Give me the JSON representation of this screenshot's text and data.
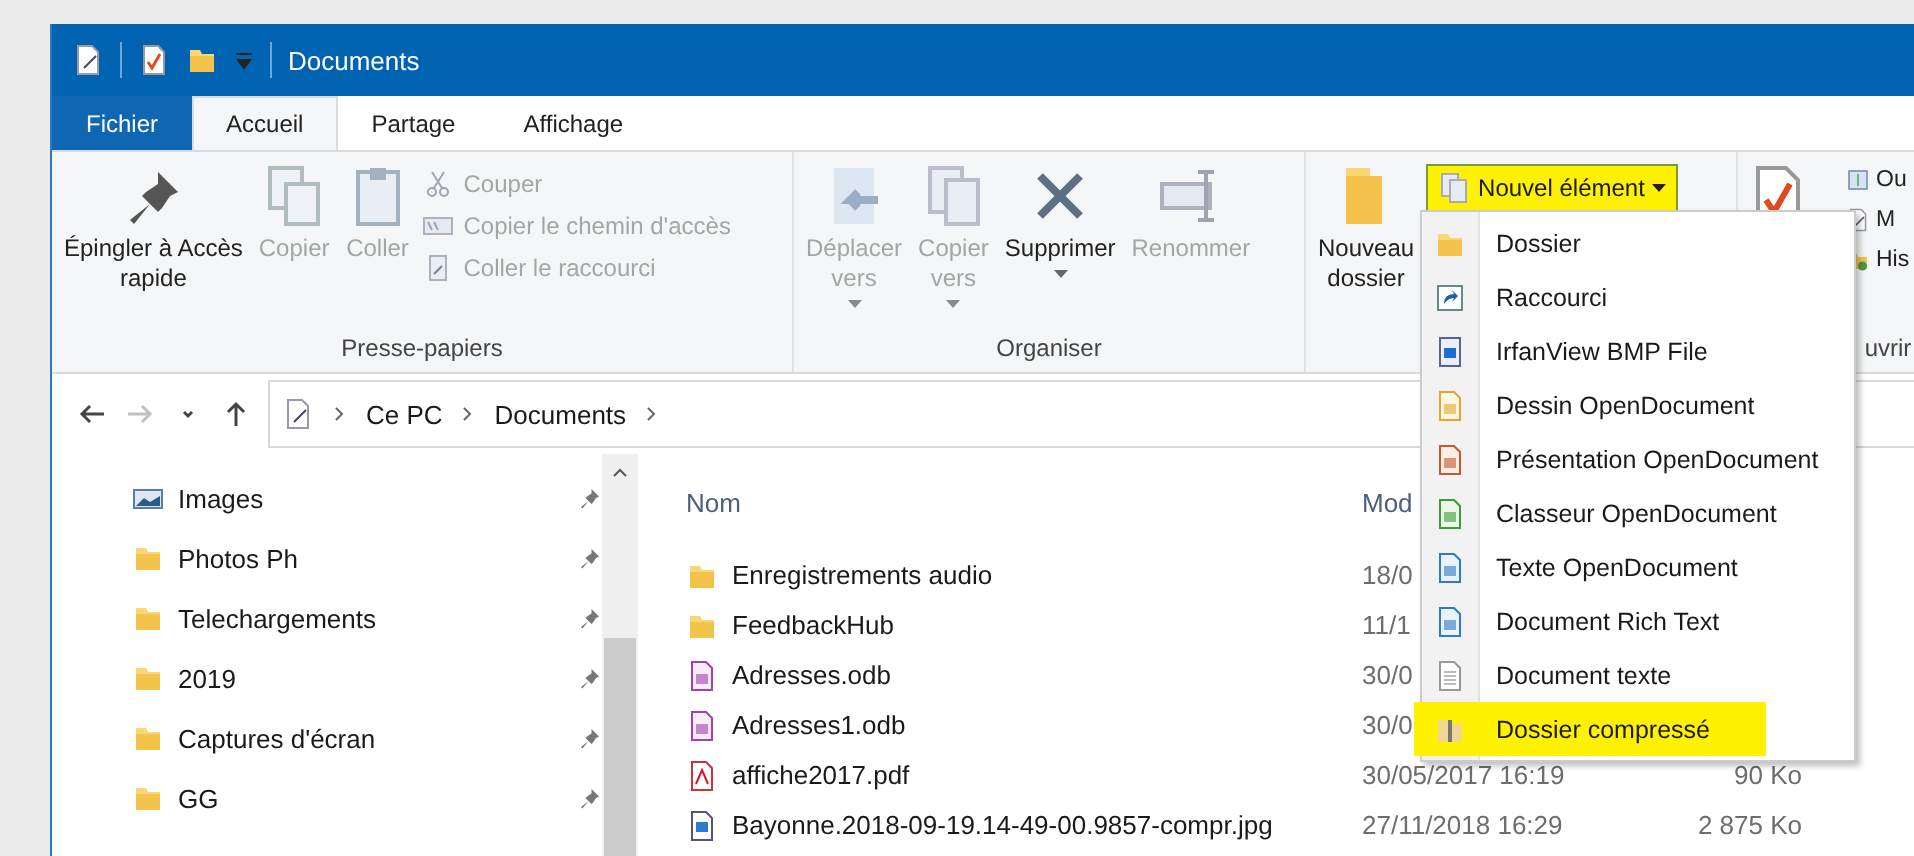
{
  "window": {
    "title": "Documents"
  },
  "tabs": [
    {
      "label": "Fichier",
      "kind": "file",
      "selected": false
    },
    {
      "label": "Accueil",
      "kind": "tab",
      "selected": true
    },
    {
      "label": "Partage",
      "kind": "tab",
      "selected": false
    },
    {
      "label": "Affichage",
      "kind": "tab",
      "selected": false
    }
  ],
  "ribbon": {
    "groups": [
      {
        "label": "Presse-papiers",
        "large": [
          {
            "label": "Épingler à Accès rapide",
            "kind": "pin",
            "disabled": false
          },
          {
            "label": "Copier",
            "kind": "copy",
            "disabled": true
          },
          {
            "label": "Coller",
            "kind": "paste",
            "disabled": true
          }
        ],
        "small": [
          {
            "label": "Couper",
            "kind": "cut",
            "disabled": true
          },
          {
            "label": "Copier le chemin d'accès",
            "kind": "path",
            "disabled": true
          },
          {
            "label": "Coller le raccourci",
            "kind": "shortcut",
            "disabled": true
          }
        ]
      },
      {
        "label": "Organiser",
        "large": [
          {
            "label": "Déplacer vers",
            "kind": "move",
            "disabled": true,
            "dropdown": true
          },
          {
            "label": "Copier vers",
            "kind": "copyto",
            "disabled": true,
            "dropdown": true
          },
          {
            "label": "Supprimer",
            "kind": "delete",
            "disabled": false,
            "dropdown": true
          },
          {
            "label": "Renommer",
            "kind": "rename",
            "disabled": true
          }
        ]
      },
      {
        "large": [
          {
            "label": "Nouveau dossier",
            "kind": "folder",
            "disabled": false
          }
        ],
        "new_item": {
          "label": "Nouvel élément",
          "highlighted": true
        }
      },
      {
        "label": "uvrir",
        "large": [
          {
            "kind": "properties"
          }
        ],
        "small": [
          {
            "label": "Ou",
            "kind": "open",
            "disabled": false
          },
          {
            "label": "M",
            "kind": "edit",
            "disabled": false
          },
          {
            "label": "His",
            "kind": "history",
            "disabled": false
          }
        ]
      }
    ]
  },
  "new_item_menu": [
    {
      "label": "Dossier",
      "kind": "folder",
      "highlighted": false
    },
    {
      "label": "Raccourci",
      "kind": "shortcut",
      "highlighted": false
    },
    {
      "label": "IrfanView BMP File",
      "kind": "bitmap",
      "highlighted": false
    },
    {
      "label": "Dessin OpenDocument",
      "kind": "drawing",
      "highlighted": false
    },
    {
      "label": "Présentation OpenDocument",
      "kind": "presentation",
      "highlighted": false
    },
    {
      "label": "Classeur OpenDocument",
      "kind": "spreadsheet",
      "highlighted": false
    },
    {
      "label": "Texte OpenDocument",
      "kind": "text",
      "highlighted": false
    },
    {
      "label": "Document Rich Text",
      "kind": "text",
      "highlighted": false
    },
    {
      "label": "Document texte",
      "kind": "plain",
      "highlighted": false
    },
    {
      "label": "Dossier compressé",
      "kind": "zip",
      "highlighted": true
    }
  ],
  "address_bar": {
    "path": [
      "Ce PC",
      "Documents"
    ]
  },
  "nav_pane": [
    {
      "label": "Images",
      "kind": "images"
    },
    {
      "label": "Photos Ph",
      "kind": "folder"
    },
    {
      "label": "Telechargements",
      "kind": "folder"
    },
    {
      "label": "2019",
      "kind": "folder"
    },
    {
      "label": "Captures d'écran",
      "kind": "folder"
    },
    {
      "label": "GG",
      "kind": "folder"
    }
  ],
  "file_list": {
    "columns": [
      "Nom",
      "Mod"
    ],
    "rows": [
      {
        "name": "Enregistrements audio",
        "kind": "folder",
        "date": "18/0",
        "size": ""
      },
      {
        "name": "FeedbackHub",
        "kind": "folder",
        "date": "11/1",
        "size": ""
      },
      {
        "name": "Adresses.odb",
        "kind": "database",
        "date": "30/0",
        "size": ""
      },
      {
        "name": "Adresses1.odb",
        "kind": "database",
        "date": "30/0",
        "size": ""
      },
      {
        "name": "affiche2017.pdf",
        "kind": "pdf",
        "date": "30/05/2017 16:19",
        "size": "90 Ko"
      },
      {
        "name": "Bayonne.2018-09-19.14-49-00.9857-compr.jpg",
        "kind": "image",
        "date": "27/11/2018 16:29",
        "size": "2 875 Ko"
      }
    ]
  }
}
